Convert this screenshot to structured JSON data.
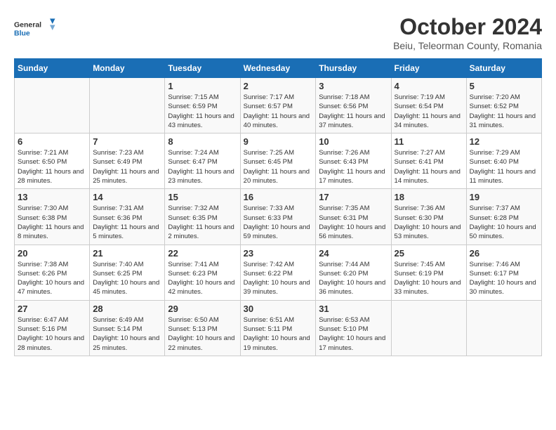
{
  "logo": {
    "text_general": "General",
    "text_blue": "Blue"
  },
  "title": "October 2024",
  "subtitle": "Beiu, Teleorman County, Romania",
  "weekdays": [
    "Sunday",
    "Monday",
    "Tuesday",
    "Wednesday",
    "Thursday",
    "Friday",
    "Saturday"
  ],
  "weeks": [
    [
      {
        "day": "",
        "info": ""
      },
      {
        "day": "",
        "info": ""
      },
      {
        "day": "1",
        "info": "Sunrise: 7:15 AM\nSunset: 6:59 PM\nDaylight: 11 hours and 43 minutes."
      },
      {
        "day": "2",
        "info": "Sunrise: 7:17 AM\nSunset: 6:57 PM\nDaylight: 11 hours and 40 minutes."
      },
      {
        "day": "3",
        "info": "Sunrise: 7:18 AM\nSunset: 6:56 PM\nDaylight: 11 hours and 37 minutes."
      },
      {
        "day": "4",
        "info": "Sunrise: 7:19 AM\nSunset: 6:54 PM\nDaylight: 11 hours and 34 minutes."
      },
      {
        "day": "5",
        "info": "Sunrise: 7:20 AM\nSunset: 6:52 PM\nDaylight: 11 hours and 31 minutes."
      }
    ],
    [
      {
        "day": "6",
        "info": "Sunrise: 7:21 AM\nSunset: 6:50 PM\nDaylight: 11 hours and 28 minutes."
      },
      {
        "day": "7",
        "info": "Sunrise: 7:23 AM\nSunset: 6:49 PM\nDaylight: 11 hours and 25 minutes."
      },
      {
        "day": "8",
        "info": "Sunrise: 7:24 AM\nSunset: 6:47 PM\nDaylight: 11 hours and 23 minutes."
      },
      {
        "day": "9",
        "info": "Sunrise: 7:25 AM\nSunset: 6:45 PM\nDaylight: 11 hours and 20 minutes."
      },
      {
        "day": "10",
        "info": "Sunrise: 7:26 AM\nSunset: 6:43 PM\nDaylight: 11 hours and 17 minutes."
      },
      {
        "day": "11",
        "info": "Sunrise: 7:27 AM\nSunset: 6:41 PM\nDaylight: 11 hours and 14 minutes."
      },
      {
        "day": "12",
        "info": "Sunrise: 7:29 AM\nSunset: 6:40 PM\nDaylight: 11 hours and 11 minutes."
      }
    ],
    [
      {
        "day": "13",
        "info": "Sunrise: 7:30 AM\nSunset: 6:38 PM\nDaylight: 11 hours and 8 minutes."
      },
      {
        "day": "14",
        "info": "Sunrise: 7:31 AM\nSunset: 6:36 PM\nDaylight: 11 hours and 5 minutes."
      },
      {
        "day": "15",
        "info": "Sunrise: 7:32 AM\nSunset: 6:35 PM\nDaylight: 11 hours and 2 minutes."
      },
      {
        "day": "16",
        "info": "Sunrise: 7:33 AM\nSunset: 6:33 PM\nDaylight: 10 hours and 59 minutes."
      },
      {
        "day": "17",
        "info": "Sunrise: 7:35 AM\nSunset: 6:31 PM\nDaylight: 10 hours and 56 minutes."
      },
      {
        "day": "18",
        "info": "Sunrise: 7:36 AM\nSunset: 6:30 PM\nDaylight: 10 hours and 53 minutes."
      },
      {
        "day": "19",
        "info": "Sunrise: 7:37 AM\nSunset: 6:28 PM\nDaylight: 10 hours and 50 minutes."
      }
    ],
    [
      {
        "day": "20",
        "info": "Sunrise: 7:38 AM\nSunset: 6:26 PM\nDaylight: 10 hours and 47 minutes."
      },
      {
        "day": "21",
        "info": "Sunrise: 7:40 AM\nSunset: 6:25 PM\nDaylight: 10 hours and 45 minutes."
      },
      {
        "day": "22",
        "info": "Sunrise: 7:41 AM\nSunset: 6:23 PM\nDaylight: 10 hours and 42 minutes."
      },
      {
        "day": "23",
        "info": "Sunrise: 7:42 AM\nSunset: 6:22 PM\nDaylight: 10 hours and 39 minutes."
      },
      {
        "day": "24",
        "info": "Sunrise: 7:44 AM\nSunset: 6:20 PM\nDaylight: 10 hours and 36 minutes."
      },
      {
        "day": "25",
        "info": "Sunrise: 7:45 AM\nSunset: 6:19 PM\nDaylight: 10 hours and 33 minutes."
      },
      {
        "day": "26",
        "info": "Sunrise: 7:46 AM\nSunset: 6:17 PM\nDaylight: 10 hours and 30 minutes."
      }
    ],
    [
      {
        "day": "27",
        "info": "Sunrise: 6:47 AM\nSunset: 5:16 PM\nDaylight: 10 hours and 28 minutes."
      },
      {
        "day": "28",
        "info": "Sunrise: 6:49 AM\nSunset: 5:14 PM\nDaylight: 10 hours and 25 minutes."
      },
      {
        "day": "29",
        "info": "Sunrise: 6:50 AM\nSunset: 5:13 PM\nDaylight: 10 hours and 22 minutes."
      },
      {
        "day": "30",
        "info": "Sunrise: 6:51 AM\nSunset: 5:11 PM\nDaylight: 10 hours and 19 minutes."
      },
      {
        "day": "31",
        "info": "Sunrise: 6:53 AM\nSunset: 5:10 PM\nDaylight: 10 hours and 17 minutes."
      },
      {
        "day": "",
        "info": ""
      },
      {
        "day": "",
        "info": ""
      }
    ]
  ]
}
